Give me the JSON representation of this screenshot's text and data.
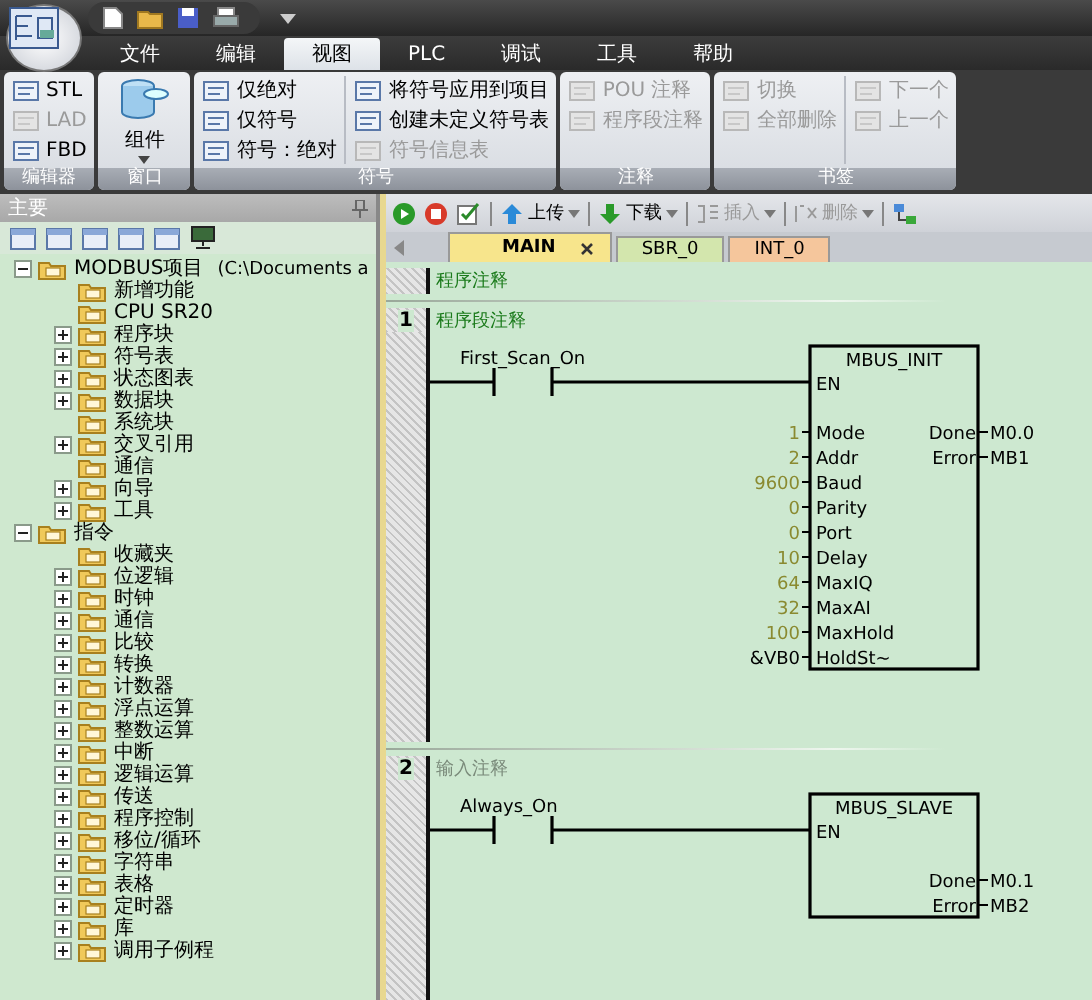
{
  "menu_tabs": [
    {
      "label": "文件",
      "selected": false
    },
    {
      "label": "编辑",
      "selected": false
    },
    {
      "label": "视图",
      "selected": true
    },
    {
      "label": "PLC",
      "selected": false
    },
    {
      "label": "调试",
      "selected": false
    },
    {
      "label": "工具",
      "selected": false
    },
    {
      "label": "帮助",
      "selected": false
    }
  ],
  "ribbon_groups": [
    {
      "label": "编辑器",
      "columns": [
        [
          {
            "label": "STL",
            "disabled": false
          },
          {
            "label": "LAD",
            "disabled": true
          },
          {
            "label": "FBD",
            "disabled": false
          }
        ]
      ]
    },
    {
      "label": "窗口",
      "large_button": {
        "label": "组件"
      }
    },
    {
      "label": "符号",
      "columns": [
        [
          {
            "label": "仅绝对",
            "disabled": false
          },
          {
            "label": "仅符号",
            "disabled": false
          },
          {
            "label": "符号：绝对",
            "disabled": false
          }
        ],
        [
          {
            "label": "将符号应用到项目",
            "disabled": false
          },
          {
            "label": "创建未定义符号表",
            "disabled": false
          },
          {
            "label": "符号信息表",
            "disabled": true
          }
        ]
      ]
    },
    {
      "label": "注释",
      "columns": [
        [
          {
            "label": "POU 注释",
            "disabled": true
          },
          {
            "label": "程序段注释",
            "disabled": true
          }
        ]
      ]
    },
    {
      "label": "书签",
      "columns": [
        [
          {
            "label": "切换",
            "disabled": true
          },
          {
            "label": "全部删除",
            "disabled": true
          }
        ],
        [
          {
            "label": "下一个",
            "disabled": true
          },
          {
            "label": "上一个",
            "disabled": true
          }
        ]
      ]
    }
  ],
  "left_panel": {
    "title": "主要",
    "tree": [
      {
        "label": "MODBUS项目",
        "path": "(C:\\Documents a",
        "expanded": true,
        "children": [
          {
            "label": "新增功能"
          },
          {
            "label": "CPU SR20"
          },
          {
            "label": "程序块",
            "expanded": false
          },
          {
            "label": "符号表",
            "expanded": false
          },
          {
            "label": "状态图表",
            "expanded": false
          },
          {
            "label": "数据块",
            "expanded": false
          },
          {
            "label": "系统块"
          },
          {
            "label": "交叉引用",
            "expanded": false
          },
          {
            "label": "通信"
          },
          {
            "label": "向导",
            "expanded": false
          },
          {
            "label": "工具",
            "expanded": false
          }
        ]
      },
      {
        "label": "指令",
        "expanded": true,
        "children": [
          {
            "label": "收藏夹"
          },
          {
            "label": "位逻辑",
            "expanded": false
          },
          {
            "label": "时钟",
            "expanded": false
          },
          {
            "label": "通信",
            "expanded": false
          },
          {
            "label": "比较",
            "expanded": false
          },
          {
            "label": "转换",
            "expanded": false
          },
          {
            "label": "计数器",
            "expanded": false
          },
          {
            "label": "浮点运算",
            "expanded": false
          },
          {
            "label": "整数运算",
            "expanded": false
          },
          {
            "label": "中断",
            "expanded": false
          },
          {
            "label": "逻辑运算",
            "expanded": false
          },
          {
            "label": "传送",
            "expanded": false
          },
          {
            "label": "程序控制",
            "expanded": false
          },
          {
            "label": "移位/循环",
            "expanded": false
          },
          {
            "label": "字符串",
            "expanded": false
          },
          {
            "label": "表格",
            "expanded": false
          },
          {
            "label": "定时器",
            "expanded": false
          },
          {
            "label": "库",
            "expanded": false
          },
          {
            "label": "调用子例程",
            "expanded": false
          }
        ]
      }
    ]
  },
  "editor": {
    "toolbar": [
      {
        "label": "上传",
        "disabled": false
      },
      {
        "label": "下载",
        "disabled": false
      },
      {
        "label": "插入",
        "disabled": true
      },
      {
        "label": "删除",
        "disabled": true
      }
    ],
    "tabs": [
      {
        "label": "MAIN",
        "selected": true,
        "color": "#f7e58c"
      },
      {
        "label": "SBR_0",
        "selected": false,
        "color": "#d3e6ad"
      },
      {
        "label": "INT_0",
        "selected": false,
        "color": "#f5c69c"
      }
    ],
    "program_comment": "程序注释",
    "networks": [
      {
        "number": "1",
        "comment": "程序段注释",
        "dimmed": false,
        "contact": "First_Scan_On",
        "block": {
          "name": "MBUS_INIT",
          "enable": "EN",
          "inputs": [
            {
              "pin": "Mode",
              "value": "1",
              "constant": true
            },
            {
              "pin": "Addr",
              "value": "2",
              "constant": true
            },
            {
              "pin": "Baud",
              "value": "9600",
              "constant": true
            },
            {
              "pin": "Parity",
              "value": "0",
              "constant": true
            },
            {
              "pin": "Port",
              "value": "0",
              "constant": true
            },
            {
              "pin": "Delay",
              "value": "10",
              "constant": true
            },
            {
              "pin": "MaxIQ",
              "value": "64",
              "constant": true
            },
            {
              "pin": "MaxAI",
              "value": "32",
              "constant": true
            },
            {
              "pin": "MaxHold",
              "value": "100",
              "constant": true
            },
            {
              "pin": "HoldSt~",
              "value": "&VB0",
              "constant": false
            }
          ],
          "outputs": [
            {
              "pin": "Done",
              "value": "M0.0"
            },
            {
              "pin": "Error",
              "value": "MB1"
            }
          ]
        }
      },
      {
        "number": "2",
        "comment": "输入注释",
        "dimmed": true,
        "contact": "Always_On",
        "block": {
          "name": "MBUS_SLAVE",
          "enable": "EN",
          "outputs": [
            {
              "pin": "Done",
              "value": "M0.1"
            },
            {
              "pin": "Error",
              "value": "MB2"
            }
          ]
        }
      }
    ]
  }
}
